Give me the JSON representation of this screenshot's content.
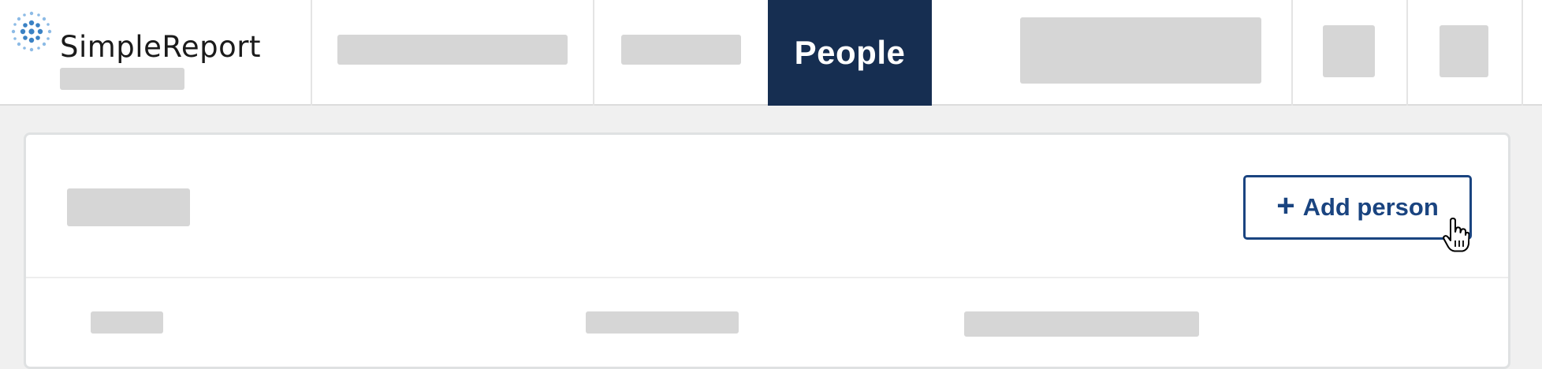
{
  "app": {
    "logo_text": "SimpleReport"
  },
  "nav": {
    "active_label": "People"
  },
  "main": {
    "add_button_label": "Add person",
    "add_button_icon": "plus-icon"
  },
  "colors": {
    "nav_active_bg": "#162e51",
    "button_border": "#1a4480",
    "skeleton": "#d6d6d6"
  }
}
